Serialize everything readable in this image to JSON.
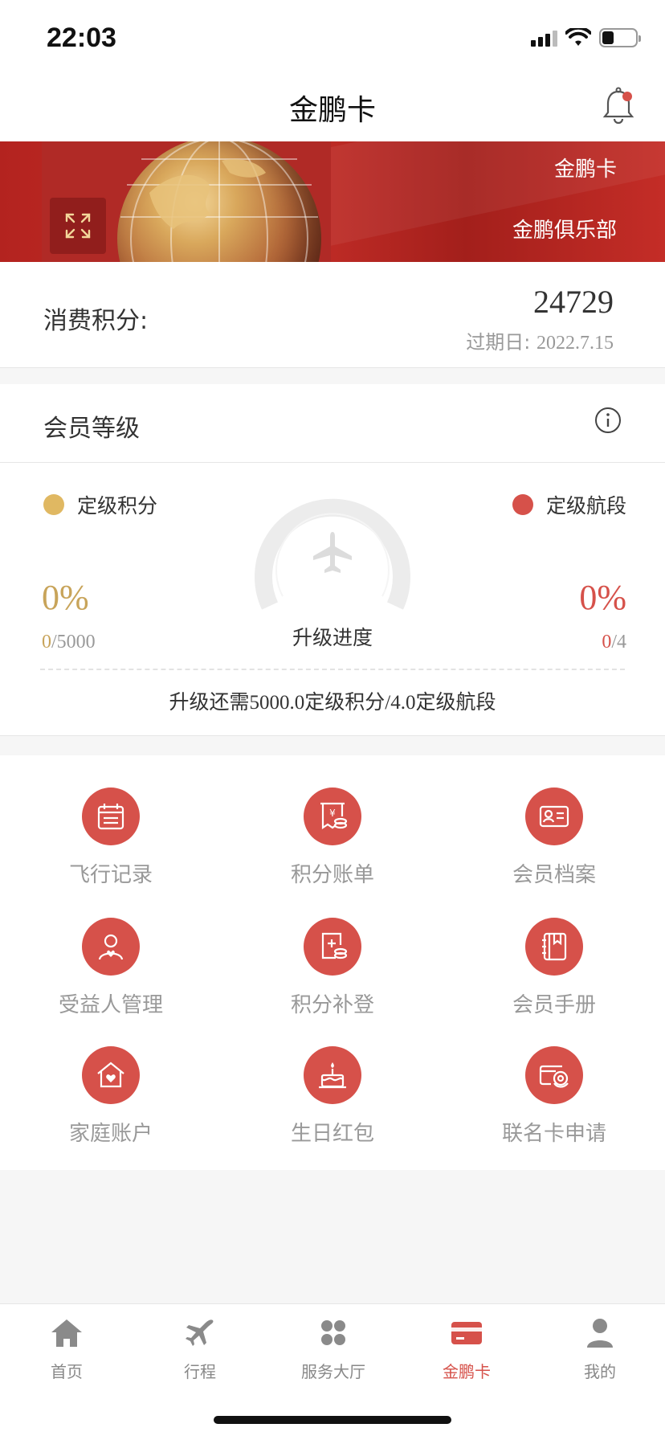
{
  "status_bar": {
    "time": "22:03"
  },
  "nav": {
    "title": "金鹏卡"
  },
  "banner": {
    "card_name": "金鹏卡",
    "club_name": "金鹏俱乐部"
  },
  "points": {
    "label": "消费积分:",
    "value": "24729",
    "expiry_label": "过期日:",
    "expiry_date": "2022.7.15"
  },
  "member": {
    "title": "会员等级",
    "legend_left": "定级积分",
    "legend_right": "定级航段",
    "left_percent": "0%",
    "left_current": "0",
    "left_total": "/5000",
    "right_percent": "0%",
    "right_current": "0",
    "right_total": "/4",
    "gauge_label": "升级进度",
    "upgrade_text": "升级还需5000.0定级积分/4.0定级航段",
    "colors": {
      "gold": "#e0b862",
      "red": "#d6514a"
    }
  },
  "services": [
    {
      "label": "飞行记录",
      "icon": "calendar-icon"
    },
    {
      "label": "积分账单",
      "icon": "points-bill-icon"
    },
    {
      "label": "会员档案",
      "icon": "id-card-icon"
    },
    {
      "label": "受益人管理",
      "icon": "beneficiary-icon"
    },
    {
      "label": "积分补登",
      "icon": "points-supplement-icon"
    },
    {
      "label": "会员手册",
      "icon": "handbook-icon"
    },
    {
      "label": "家庭账户",
      "icon": "family-home-icon"
    },
    {
      "label": "生日红包",
      "icon": "birthday-cake-icon"
    },
    {
      "label": "联名卡申请",
      "icon": "cobrand-card-icon"
    }
  ],
  "tabs": [
    {
      "label": "首页",
      "icon": "home-icon"
    },
    {
      "label": "行程",
      "icon": "plane-icon"
    },
    {
      "label": "服务大厅",
      "icon": "services-grid-icon"
    },
    {
      "label": "金鹏卡",
      "icon": "card-icon",
      "active": true
    },
    {
      "label": "我的",
      "icon": "profile-icon"
    }
  ],
  "accent_color": "#d6514a"
}
